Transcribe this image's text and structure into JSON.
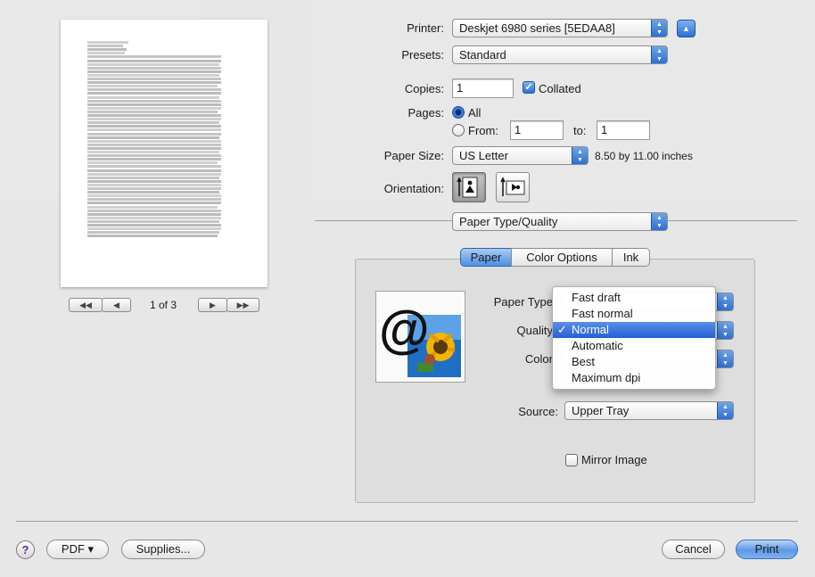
{
  "printer": {
    "label": "Printer:",
    "value": "Deskjet 6980 series [5EDAA8]"
  },
  "presets": {
    "label": "Presets:",
    "value": "Standard"
  },
  "copies": {
    "label": "Copies:",
    "value": "1",
    "collated_label": "Collated",
    "collated": true
  },
  "pages": {
    "label": "Pages:",
    "all_label": "All",
    "from_label": "From:",
    "from_value": "1",
    "to_label": "to:",
    "to_value": "1",
    "selected": "all"
  },
  "paper_size": {
    "label": "Paper Size:",
    "value": "US Letter",
    "dimensions": "8.50 by 11.00 inches"
  },
  "orientation": {
    "label": "Orientation:",
    "selected": "portrait"
  },
  "panel_select": {
    "value": "Paper Type/Quality"
  },
  "tabs": [
    {
      "label": "Paper",
      "selected": true
    },
    {
      "label": "Color Options",
      "selected": false
    },
    {
      "label": "Ink",
      "selected": false
    }
  ],
  "paper_tab": {
    "paper_type_label": "Paper Type",
    "quality_label": "Quality",
    "color_label": "Color",
    "source_label": "Source:",
    "source_value": "Upper Tray",
    "mirror_label": "Mirror Image",
    "mirror_checked": false
  },
  "quality_menu": {
    "items": [
      "Fast draft",
      "Fast normal",
      "Normal",
      "Automatic",
      "Best",
      "Maximum dpi"
    ],
    "selected_index": 2
  },
  "preview": {
    "page_indicator": "1 of 3"
  },
  "footer": {
    "help_label": "?",
    "pdf_label": "PDF ▾",
    "supplies_label": "Supplies...",
    "cancel_label": "Cancel",
    "print_label": "Print"
  },
  "icons": {
    "popup_arrows": "updown-arrows-icon",
    "disclosure": "disclosure-triangle-icon",
    "portrait": "portrait-orientation-icon",
    "landscape": "landscape-orientation-icon",
    "checkmark": "checkmark-icon"
  },
  "colors": {
    "accent": "#2e6fd1",
    "menu_highlight": "#3a76dc"
  }
}
